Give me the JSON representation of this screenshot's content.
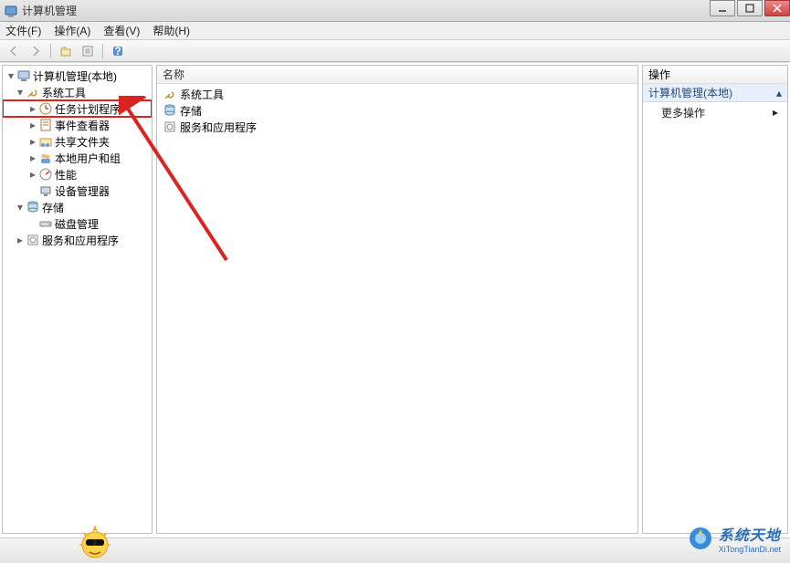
{
  "window": {
    "title": "计算机管理"
  },
  "menu": {
    "file": "文件(F)",
    "action": "操作(A)",
    "view": "查看(V)",
    "help": "帮助(H)"
  },
  "tree": {
    "root": "计算机管理(本地)",
    "system_tools": "系统工具",
    "task_scheduler": "任务计划程序",
    "event_viewer": "事件查看器",
    "shared_folders": "共享文件夹",
    "local_users": "本地用户和组",
    "performance": "性能",
    "device_manager": "设备管理器",
    "storage": "存储",
    "disk_management": "磁盘管理",
    "services_apps": "服务和应用程序"
  },
  "mid": {
    "col_name": "名称",
    "items": {
      "system_tools": "系统工具",
      "storage": "存储",
      "services_apps": "服务和应用程序"
    }
  },
  "actions": {
    "header": "操作",
    "section": "计算机管理(本地)",
    "more": "更多操作"
  },
  "brand": {
    "name": "系统天地",
    "url": "XiTongTianDi.net"
  }
}
